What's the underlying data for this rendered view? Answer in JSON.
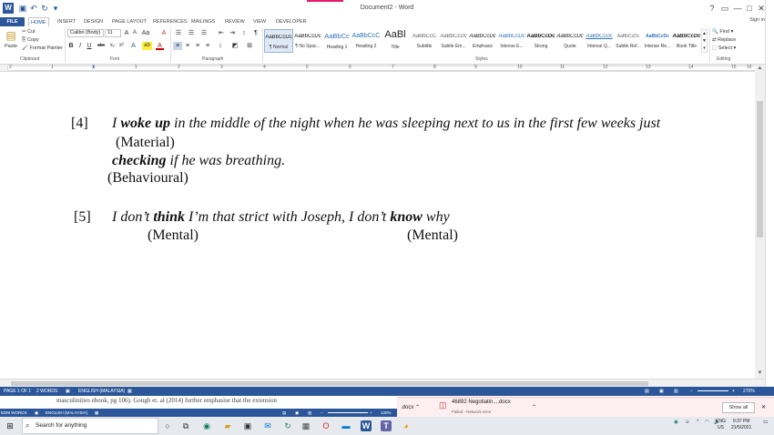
{
  "window": {
    "title": "Document2 - Word",
    "help": "?",
    "restore": "▭",
    "minimize": "—",
    "maximize": "□",
    "close": "✕",
    "signin": "Sign in"
  },
  "qat": {
    "save": "▣",
    "undo": "↶",
    "redo": "↻",
    "customize": "▾"
  },
  "tabs": [
    "FILE",
    "HOME",
    "INSERT",
    "DESIGN",
    "PAGE LAYOUT",
    "REFERENCES",
    "MAILINGS",
    "REVIEW",
    "VIEW",
    "DEVELOPER"
  ],
  "ribbon": {
    "clipboard": {
      "paste": "Paste",
      "cut": "Cut",
      "copy": "Copy",
      "format_painter": "Format Painter",
      "label": "Clipboard"
    },
    "font": {
      "name": "Calibri (Body)",
      "size": "11",
      "grow": "A",
      "shrink": "A",
      "case": "Aa",
      "clear": "A",
      "bold": "B",
      "italic": "I",
      "underline": "U",
      "strike": "abc",
      "subscript": "x₂",
      "superscript": "x²",
      "effects": "A",
      "highlight": "ab",
      "color": "A",
      "label": "Font"
    },
    "paragraph": {
      "bullets": "☰",
      "numbering": "☰",
      "multilevel": "☰",
      "decrease": "⇤",
      "increase": "⇥",
      "sort": "↕",
      "show": "¶",
      "left": "≡",
      "center": "≡",
      "right": "≡",
      "justify": "≡",
      "spacing": "↕",
      "shading": "◩",
      "borders": "⊞",
      "label": "Paragraph"
    },
    "styles": {
      "label": "Styles",
      "items": [
        {
          "sample": "AaBbCcDc",
          "name": "¶ Normal"
        },
        {
          "sample": "AaBbCcDc",
          "name": "¶ No Spac..."
        },
        {
          "sample": "AaBbCc",
          "name": "Heading 1"
        },
        {
          "sample": "AaBbCcC",
          "name": "Heading 2"
        },
        {
          "sample": "AaBl",
          "name": "Title"
        },
        {
          "sample": "AaBbCcC",
          "name": "Subtitle"
        },
        {
          "sample": "AaBbCcDc",
          "name": "Subtle Em..."
        },
        {
          "sample": "AaBbCcDc",
          "name": "Emphasis"
        },
        {
          "sample": "AaBbCcDc",
          "name": "Intense E..."
        },
        {
          "sample": "AaBbCcDc",
          "name": "Strong"
        },
        {
          "sample": "AaBbCcDc",
          "name": "Quote"
        },
        {
          "sample": "AaBbCcDc",
          "name": "Intense Q..."
        },
        {
          "sample": "AaBbCcDc",
          "name": "Subtle Ref..."
        },
        {
          "sample": "AaBbCcDc",
          "name": "Intense Re..."
        },
        {
          "sample": "AaBbCcDc",
          "name": "Book Title"
        }
      ]
    },
    "editing": {
      "find": "Find",
      "replace": "Replace",
      "select": "Select",
      "label": "Editing"
    }
  },
  "ruler": {
    "numbers": [
      "2",
      "1",
      "1",
      "2",
      "3",
      "4",
      "5",
      "6",
      "7",
      "8",
      "9",
      "10",
      "11",
      "12",
      "13",
      "14",
      "15",
      "16"
    ]
  },
  "document": {
    "ex4": {
      "num": "[4]",
      "l1_a": "I ",
      "l1_b": "woke up",
      "l1_c": " in the middle of the night when he was sleeping next to us in the first few weeks just",
      "label1": "(Material)",
      "l2_a": "checking",
      "l2_b": " if he was breathing.",
      "label2": "(Behavioural)"
    },
    "ex5": {
      "num": "[5]",
      "l1_a": "I don’t ",
      "l1_b": "think",
      "l1_c": " I’m that strict with Joseph, I don’t ",
      "l1_d": "know",
      "l1_e": " why",
      "label1": "(Mental)",
      "label2": "(Mental)"
    }
  },
  "status": {
    "page": "PAGE 1 OF 1",
    "words": "2 WORDS",
    "language": "ENGLISH (MALAYSIA)",
    "zoom": "270%"
  },
  "background_window": {
    "text": "masculinities ebook, pg 106). Gough et. al (2014) further emphasise that the extension",
    "words": "8299 WORDS",
    "language": "ENGLISH (MALAYSIA)",
    "zoom": "120%"
  },
  "downloads": {
    "item1": ".docx",
    "item2_name": "46892 Negotiatin....docx",
    "item2_status": "Failed - Network error",
    "show_all": "Show all",
    "close": "✕"
  },
  "taskbar": {
    "search_placeholder": "Search for anything",
    "lang": "ENG",
    "region": "US",
    "time": "9:37 PM",
    "date": "21/5/2021"
  }
}
